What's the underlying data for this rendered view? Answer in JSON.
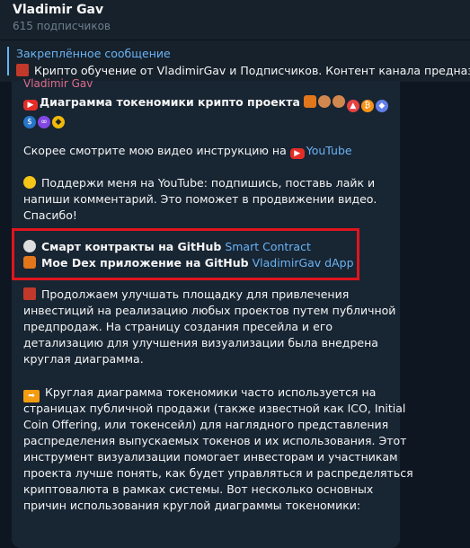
{
  "header": {
    "channel_name": "Vladimir Gav",
    "subscribers": "615 подписчиков"
  },
  "pinned": {
    "title": "Закреплённое сообщение",
    "text": "Крипто обучение от VladimirGav и Подписчиков.  Контент канала предназ"
  },
  "message": {
    "author": "Vladimir Gav",
    "line1": "Диаграмма токеномики крипто проекта",
    "line2_text": "Скорее смотрите мою видео инструкцию на",
    "line2_link": "YouTube",
    "support": [
      "Поддержи меня на YouTube: подпишись, поставь лайк и",
      "напиши комментарий. Это поможет в продвижении видео.",
      "Спасибо!"
    ],
    "github_text": "Смарт контракты на GitHub",
    "github_link": "Smart Contract",
    "dex_text": "Мое Dex приложение на GitHub",
    "dex_link": "VladimirGav dApp",
    "para1": [
      "Продолжаем улучшать площадку для привлечения",
      "инвестиций на реализацию любых проектов путем публичной",
      "предпродаж. На страницу создания пресейла и его",
      "детализацию для улучшения визуализации была внедрена",
      "круглая диаграмма."
    ],
    "para2": [
      "Круглая диаграмма токеномики часто используется на",
      "страницах публичной продажи (также известной как ICO, Initial",
      "Coin Offering, или токенсейл) для наглядного представления",
      "распределения выпускаемых токенов и их использования. Этот",
      "инструмент визуализации помогает инвесторам и участникам",
      "проекта лучше понять, как будет управляться и распределяться",
      "криптовалюта в рамках системы. Вот несколько основных",
      "причин использования круглой диаграммы токеномики:"
    ]
  }
}
